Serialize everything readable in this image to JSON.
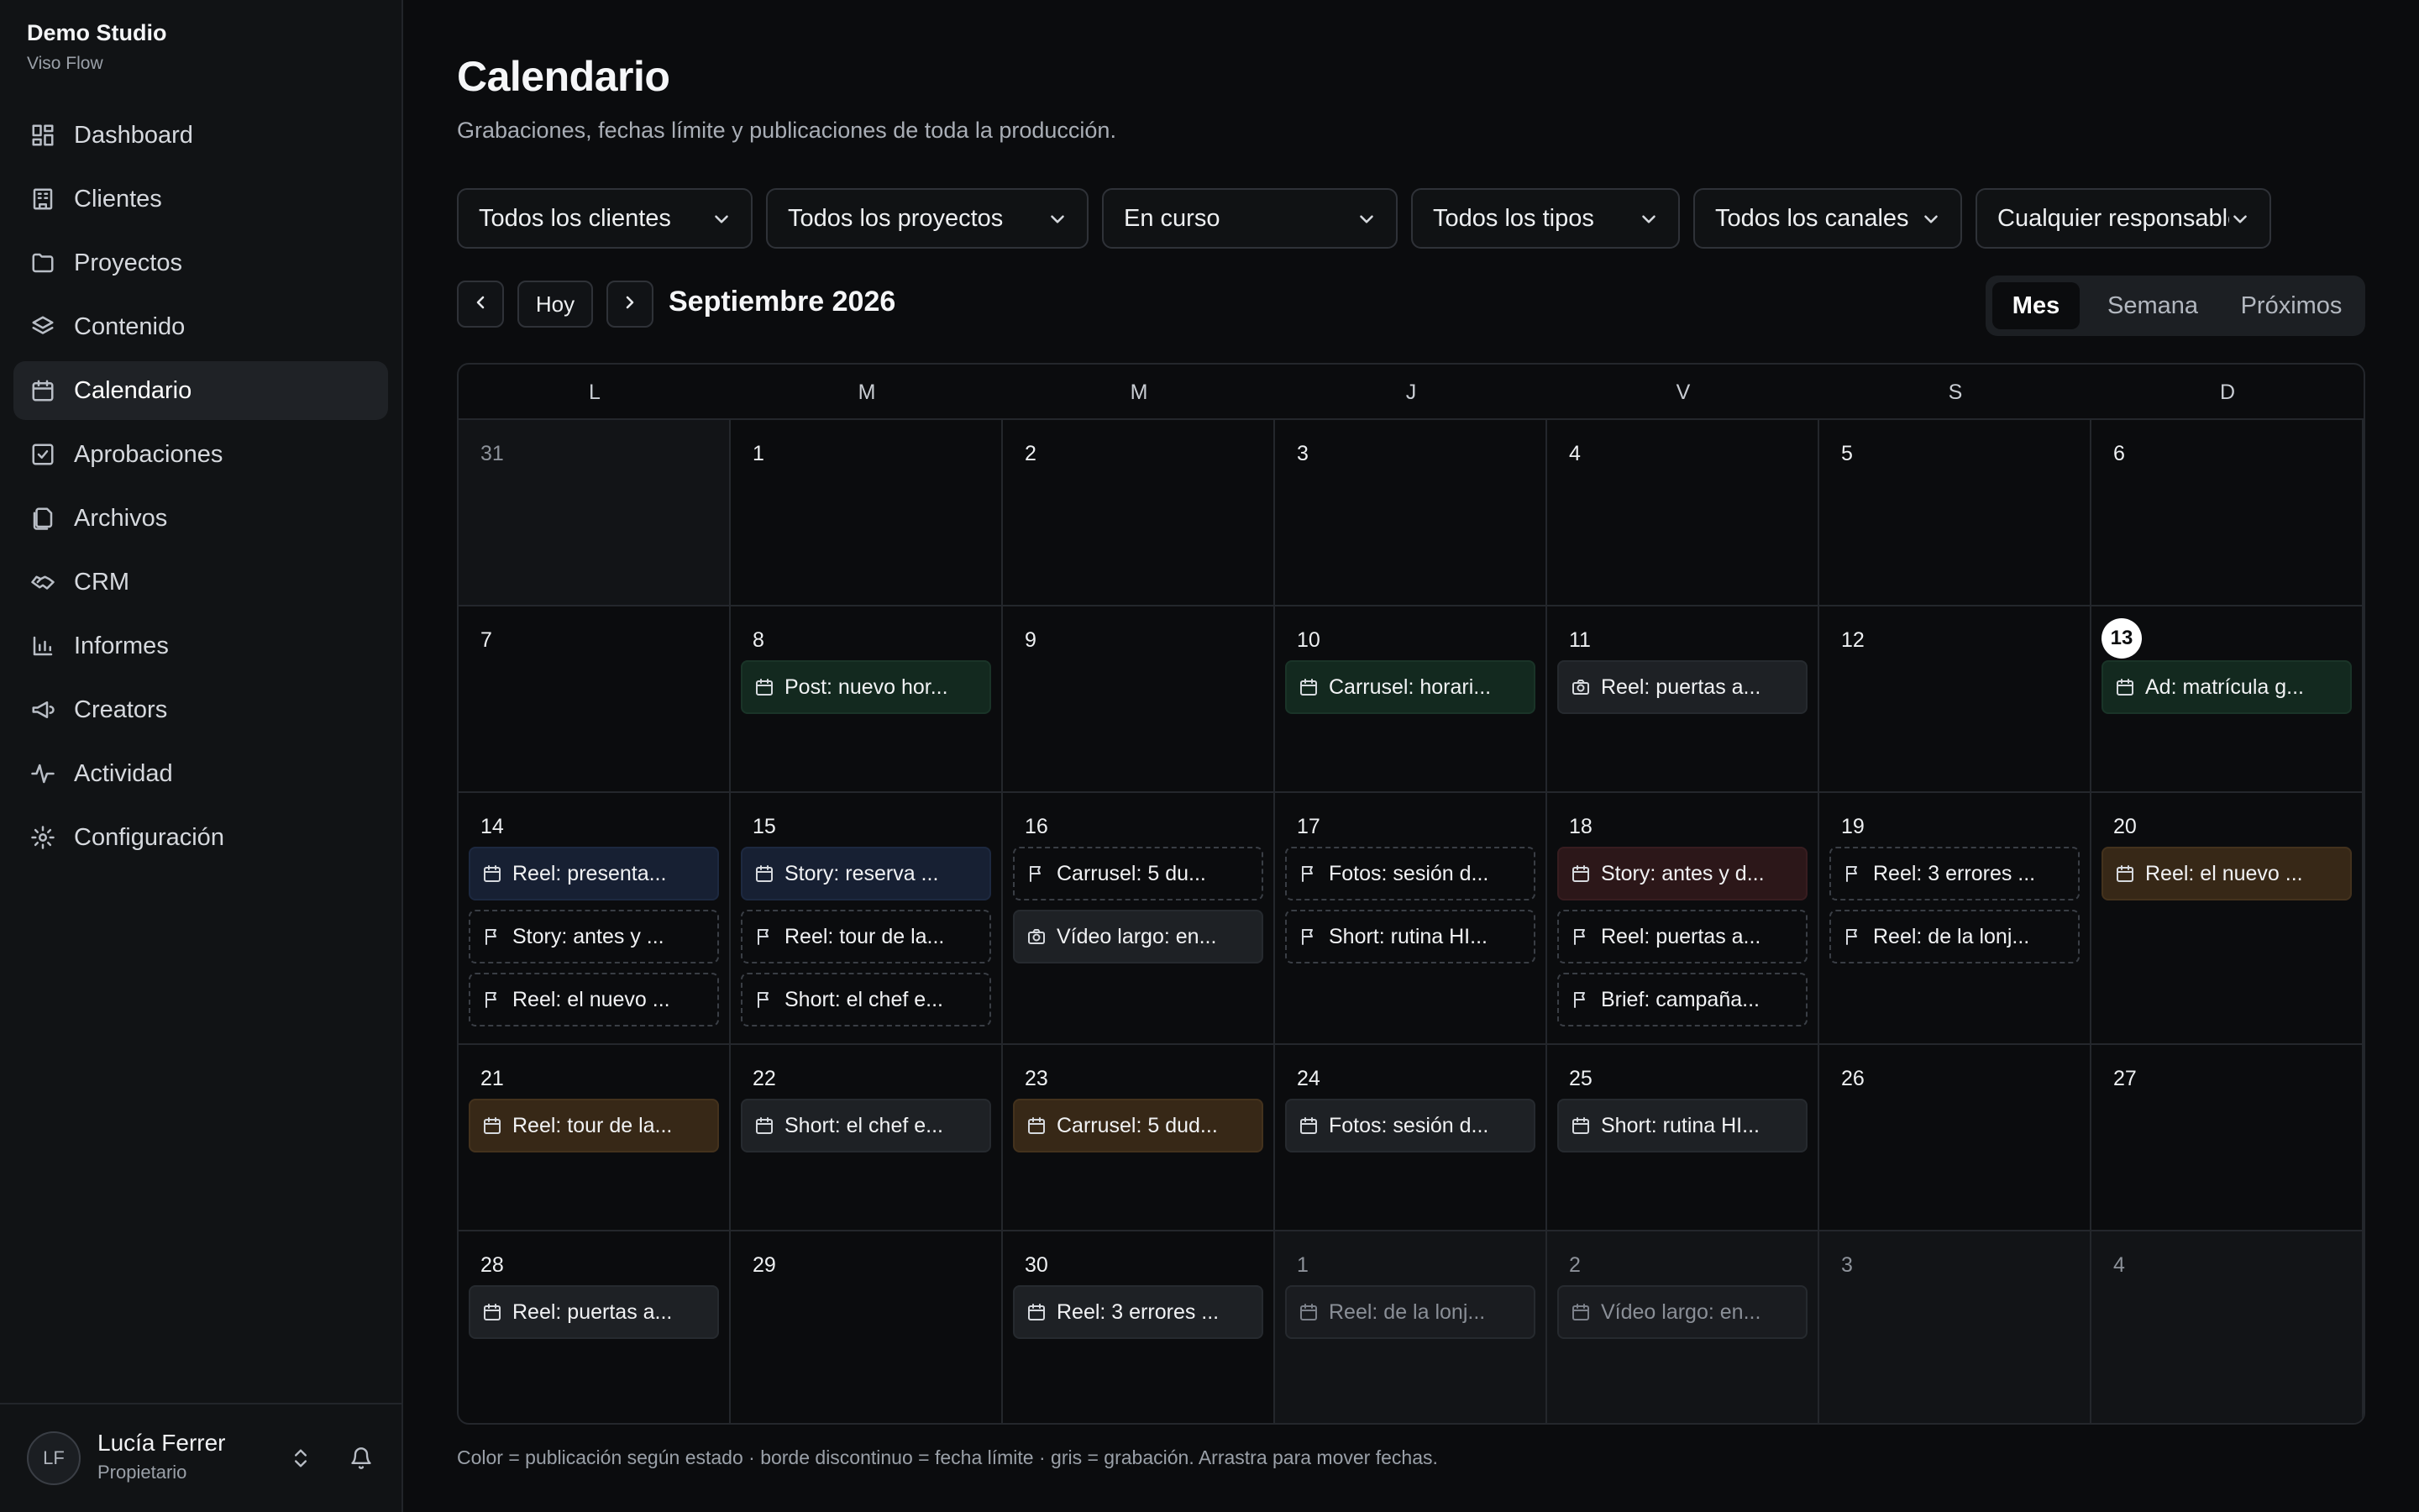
{
  "app": {
    "name": "Demo Studio",
    "sub": "Viso Flow"
  },
  "nav": [
    {
      "label": "Dashboard",
      "icon": "dashboard-icon"
    },
    {
      "label": "Clientes",
      "icon": "building-icon"
    },
    {
      "label": "Proyectos",
      "icon": "folder-icon"
    },
    {
      "label": "Contenido",
      "icon": "layers-icon"
    },
    {
      "label": "Calendario",
      "icon": "calendar-icon",
      "active": true
    },
    {
      "label": "Aprobaciones",
      "icon": "check-square-icon"
    },
    {
      "label": "Archivos",
      "icon": "files-icon"
    },
    {
      "label": "CRM",
      "icon": "handshake-icon"
    },
    {
      "label": "Informes",
      "icon": "bar-chart-icon"
    },
    {
      "label": "Creators",
      "icon": "megaphone-icon"
    },
    {
      "label": "Actividad",
      "icon": "activity-icon"
    },
    {
      "label": "Configuración",
      "icon": "gear-icon"
    }
  ],
  "user": {
    "initials": "LF",
    "name": "Lucía Ferrer",
    "role": "Propietario"
  },
  "page": {
    "title": "Calendario",
    "subtitle": "Grabaciones, fechas límite y publicaciones de toda la producción."
  },
  "filters": [
    "Todos los clientes",
    "Todos los proyectos",
    "En curso",
    "Todos los tipos",
    "Todos los canales",
    "Cualquier responsable"
  ],
  "calendar_nav": {
    "today": "Hoy",
    "month": "Septiembre 2026"
  },
  "views": [
    {
      "label": "Mes",
      "active": true
    },
    {
      "label": "Semana"
    },
    {
      "label": "Próximos"
    }
  ],
  "weekdays": [
    "L",
    "M",
    "M",
    "J",
    "V",
    "S",
    "D"
  ],
  "weeks": [
    [
      {
        "day": "31",
        "out": true,
        "events": []
      },
      {
        "day": "1",
        "events": []
      },
      {
        "day": "2",
        "events": []
      },
      {
        "day": "3",
        "events": []
      },
      {
        "day": "4",
        "events": []
      },
      {
        "day": "5",
        "events": []
      },
      {
        "day": "6",
        "events": []
      }
    ],
    [
      {
        "day": "7",
        "events": []
      },
      {
        "day": "8",
        "events": [
          {
            "title": "Post: nuevo hor...",
            "kind": "publication",
            "color": "green"
          }
        ]
      },
      {
        "day": "9",
        "events": []
      },
      {
        "day": "10",
        "events": [
          {
            "title": "Carrusel: horari...",
            "kind": "publication",
            "color": "green"
          }
        ]
      },
      {
        "day": "11",
        "events": [
          {
            "title": "Reel: puertas a...",
            "kind": "recording",
            "color": "grey"
          }
        ]
      },
      {
        "day": "12",
        "events": []
      },
      {
        "day": "13",
        "today": true,
        "events": [
          {
            "title": "Ad: matrícula g...",
            "kind": "publication",
            "color": "green"
          }
        ]
      }
    ],
    [
      {
        "day": "14",
        "events": [
          {
            "title": "Reel: presenta...",
            "kind": "publication",
            "color": "blue"
          },
          {
            "title": "Story: antes y ...",
            "kind": "deadline"
          },
          {
            "title": "Reel: el nuevo ...",
            "kind": "deadline"
          }
        ]
      },
      {
        "day": "15",
        "events": [
          {
            "title": "Story: reserva ...",
            "kind": "publication",
            "color": "blue"
          },
          {
            "title": "Reel: tour de la...",
            "kind": "deadline"
          },
          {
            "title": "Short: el chef e...",
            "kind": "deadline"
          }
        ]
      },
      {
        "day": "16",
        "events": [
          {
            "title": "Carrusel: 5 du...",
            "kind": "deadline"
          },
          {
            "title": "Vídeo largo: en...",
            "kind": "recording",
            "color": "grey"
          }
        ]
      },
      {
        "day": "17",
        "events": [
          {
            "title": "Fotos: sesión d...",
            "kind": "deadline"
          },
          {
            "title": "Short: rutina HI...",
            "kind": "deadline"
          }
        ]
      },
      {
        "day": "18",
        "events": [
          {
            "title": "Story: antes y d...",
            "kind": "publication",
            "color": "red"
          },
          {
            "title": "Reel: puertas a...",
            "kind": "deadline"
          },
          {
            "title": "Brief: campaña...",
            "kind": "deadline"
          }
        ]
      },
      {
        "day": "19",
        "events": [
          {
            "title": "Reel: 3 errores ...",
            "kind": "deadline"
          },
          {
            "title": "Reel: de la lonj...",
            "kind": "deadline"
          }
        ]
      },
      {
        "day": "20",
        "events": [
          {
            "title": "Reel: el nuevo ...",
            "kind": "publication",
            "color": "amber"
          }
        ]
      }
    ],
    [
      {
        "day": "21",
        "events": [
          {
            "title": "Reel: tour de la...",
            "kind": "publication",
            "color": "amber"
          }
        ]
      },
      {
        "day": "22",
        "events": [
          {
            "title": "Short: el chef e...",
            "kind": "publication",
            "color": "grey"
          }
        ]
      },
      {
        "day": "23",
        "events": [
          {
            "title": "Carrusel: 5 dud...",
            "kind": "publication",
            "color": "amber"
          }
        ]
      },
      {
        "day": "24",
        "events": [
          {
            "title": "Fotos: sesión d...",
            "kind": "publication",
            "color": "grey"
          }
        ]
      },
      {
        "day": "25",
        "events": [
          {
            "title": "Short: rutina HI...",
            "kind": "publication",
            "color": "grey"
          }
        ]
      },
      {
        "day": "26",
        "events": []
      },
      {
        "day": "27",
        "events": []
      }
    ],
    [
      {
        "day": "28",
        "events": [
          {
            "title": "Reel: puertas a...",
            "kind": "publication",
            "color": "grey"
          }
        ]
      },
      {
        "day": "29",
        "events": []
      },
      {
        "day": "30",
        "events": [
          {
            "title": "Reel: 3 errores ...",
            "kind": "publication",
            "color": "grey"
          }
        ]
      },
      {
        "day": "1",
        "out": true,
        "events": [
          {
            "title": "Reel: de la lonj...",
            "kind": "publication",
            "color": "grey",
            "muted": true
          }
        ]
      },
      {
        "day": "2",
        "out": true,
        "events": [
          {
            "title": "Vídeo largo: en...",
            "kind": "publication",
            "color": "grey",
            "muted": true
          }
        ]
      },
      {
        "day": "3",
        "out": true,
        "events": []
      },
      {
        "day": "4",
        "out": true,
        "events": []
      }
    ]
  ],
  "footnote": "Color = publicación según estado · borde discontinuo = fecha límite · gris = grabación. Arrastra para mover fechas."
}
